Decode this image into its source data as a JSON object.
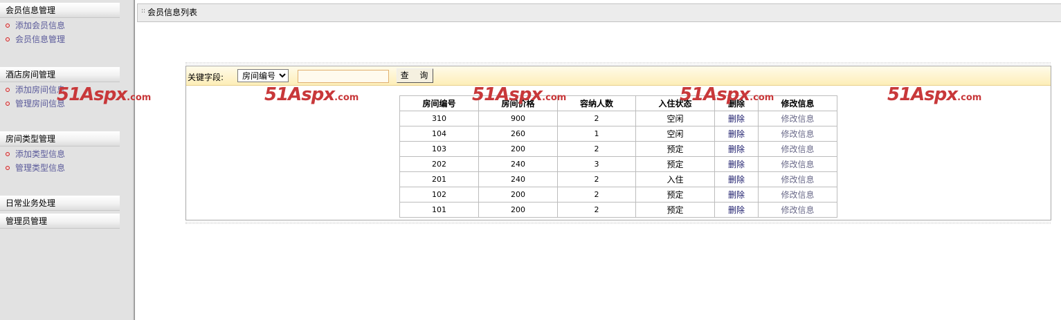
{
  "sidebar": {
    "sections": [
      {
        "header": "会员信息管理",
        "items": [
          "添加会员信息",
          "会员信息管理"
        ]
      },
      {
        "header": "酒店房间管理",
        "items": [
          "添加房间信息",
          "管理房间信息"
        ]
      },
      {
        "header": "房间类型管理",
        "items": [
          "添加类型信息",
          "管理类型信息"
        ]
      },
      {
        "header": "日常业务处理",
        "items": []
      },
      {
        "header": "管理员管理",
        "items": []
      }
    ]
  },
  "main": {
    "title": "会员信息列表",
    "search": {
      "label": "关键字段:",
      "select_value": "房间编号",
      "input_value": "",
      "button_label": "查 询"
    },
    "table": {
      "columns": [
        "房间编号",
        "房间价格",
        "容纳人数",
        "入住状态",
        "删除",
        "修改信息"
      ],
      "rows": [
        [
          "310",
          "900",
          "2",
          "空闲",
          "删除",
          "修改信息"
        ],
        [
          "104",
          "260",
          "1",
          "空闲",
          "删除",
          "修改信息"
        ],
        [
          "103",
          "200",
          "2",
          "预定",
          "删除",
          "修改信息"
        ],
        [
          "202",
          "240",
          "3",
          "预定",
          "删除",
          "修改信息"
        ],
        [
          "201",
          "240",
          "2",
          "入住",
          "删除",
          "修改信息"
        ],
        [
          "102",
          "200",
          "2",
          "预定",
          "删除",
          "修改信息"
        ],
        [
          "101",
          "200",
          "2",
          "预定",
          "删除",
          "修改信息"
        ]
      ]
    }
  },
  "watermark": {
    "brand": "51Aspx",
    "suffix": ".com",
    "color": "#c8383a"
  },
  "colors": {
    "sidebar_bg": "#e2e2e2",
    "link": "#5a5a9a",
    "bullet": "#cc2222",
    "search_bar": "#fdeeb8"
  }
}
